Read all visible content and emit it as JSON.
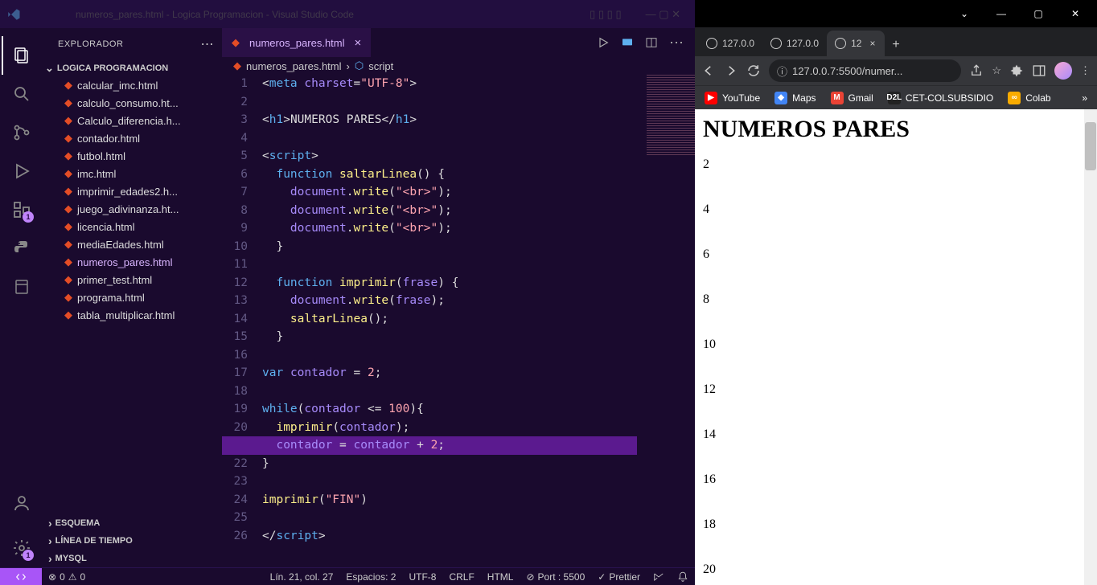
{
  "vscode": {
    "title": "numeros_pares.html - Logica Programacion - Visual Studio Code",
    "explorer_label": "EXPLORADOR",
    "folder_name": "LOGICA PROGRAMACION",
    "files": [
      "calcular_imc.html",
      "calculo_consumo.ht...",
      "Calculo_diferencia.h...",
      "contador.html",
      "futbol.html",
      "imc.html",
      "imprimir_edades2.h...",
      "juego_adivinanza.ht...",
      "licencia.html",
      "mediaEdades.html",
      "numeros_pares.html",
      "primer_test.html",
      "programa.html",
      "tabla_multiplicar.html"
    ],
    "active_file_index": 10,
    "sections": [
      "ESQUEMA",
      "LÍNEA DE TIEMPO",
      "MYSQL"
    ],
    "tab_name": "numeros_pares.html",
    "breadcrumb_file": "numeros_pares.html",
    "breadcrumb_part": "script",
    "statusbar": {
      "errors": "0",
      "warnings": "0",
      "line_col": "Lín. 21, col. 27",
      "spaces": "Espacios: 2",
      "encoding": "UTF-8",
      "eol": "CRLF",
      "lang": "HTML",
      "port": "Port : 5500",
      "prettier": "Prettier"
    },
    "code_lines": 26,
    "highlighted_line": 21
  },
  "browser": {
    "tabs": [
      "127.0.0",
      "127.0.0",
      "12"
    ],
    "active_tab_index": 2,
    "url": "127.0.0.7:5500/numer...",
    "bookmarks": [
      {
        "name": "YouTube",
        "color": "#ff0000"
      },
      {
        "name": "Maps",
        "color": "#4285f4"
      },
      {
        "name": "Gmail",
        "color": "#ea4335"
      },
      {
        "name": "CET-COLSUBSIDIO",
        "color": "#222"
      },
      {
        "name": "Colab",
        "color": "#f9ab00"
      }
    ],
    "page": {
      "heading": "NUMEROS PARES",
      "numbers": [
        "2",
        "4",
        "6",
        "8",
        "10",
        "12",
        "14",
        "16",
        "18",
        "20"
      ]
    }
  }
}
